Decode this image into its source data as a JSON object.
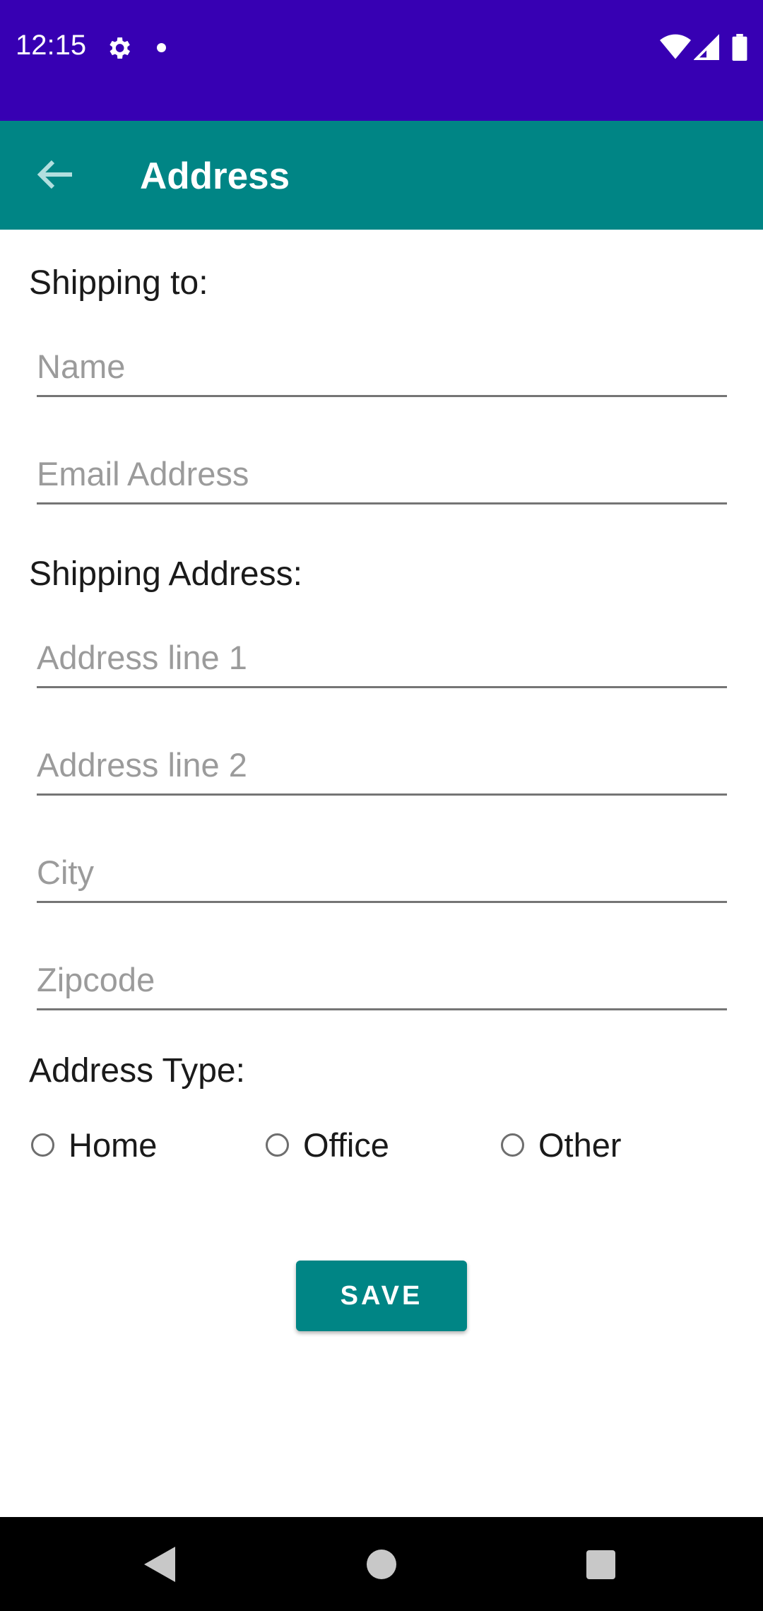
{
  "status_bar": {
    "time": "12:15",
    "icons": [
      "gear-icon",
      "notification-dot-icon",
      "wifi-icon",
      "signal-icon",
      "battery-icon"
    ]
  },
  "app_bar": {
    "title": "Address",
    "back_icon": "arrow-left-icon",
    "color": "#008585"
  },
  "form": {
    "shipping_to_label": "Shipping to:",
    "name_placeholder": "Name",
    "email_placeholder": "Email Address",
    "shipping_address_label": "Shipping Address:",
    "address1_placeholder": "Address line 1",
    "address2_placeholder": "Address line 2",
    "city_placeholder": "City",
    "zipcode_placeholder": "Zipcode",
    "address_type_label": "Address Type:",
    "address_types": [
      "Home",
      "Office",
      "Other"
    ],
    "save_label": "SAVE"
  },
  "colors": {
    "status_bar": "#3700b3",
    "accent": "#008585",
    "nav_bar": "#000000"
  }
}
